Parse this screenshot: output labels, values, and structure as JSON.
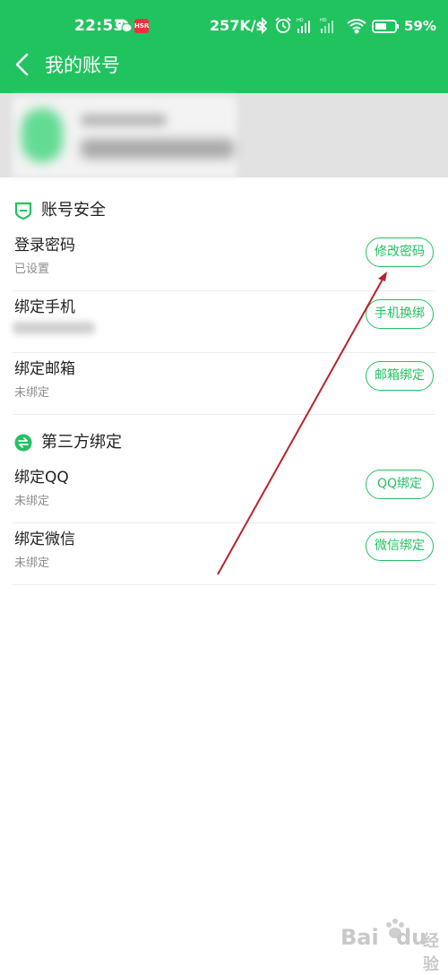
{
  "status_bar": {
    "time": "22:53",
    "app_badge": "HSR",
    "net_speed": "257K/s",
    "battery_pct": "59%"
  },
  "header": {
    "title": "我的账号"
  },
  "account_security": {
    "title": "账号安全",
    "rows": [
      {
        "title": "登录密码",
        "sub": "已设置",
        "action": "修改密码"
      },
      {
        "title": "绑定手机",
        "sub": "",
        "action": "手机换绑"
      },
      {
        "title": "绑定邮箱",
        "sub": "未绑定",
        "action": "邮箱绑定"
      }
    ]
  },
  "third_party": {
    "title": "第三方绑定",
    "rows": [
      {
        "title": "绑定QQ",
        "sub": "未绑定",
        "action": "QQ绑定"
      },
      {
        "title": "绑定微信",
        "sub": "未绑定",
        "action": "微信绑定"
      }
    ]
  },
  "watermark": {
    "part_a": "Bai",
    "part_b": "du",
    "part_c": "经验"
  },
  "colors": {
    "brand_green": "#21c35f",
    "annotation_arrow": "#b8242a"
  },
  "icons": [
    "chevron-left-icon",
    "wechat-icon",
    "bluetooth-icon",
    "alarm-icon",
    "signal-icon",
    "wifi-icon",
    "battery-icon",
    "shield-icon",
    "exchange-icon"
  ]
}
